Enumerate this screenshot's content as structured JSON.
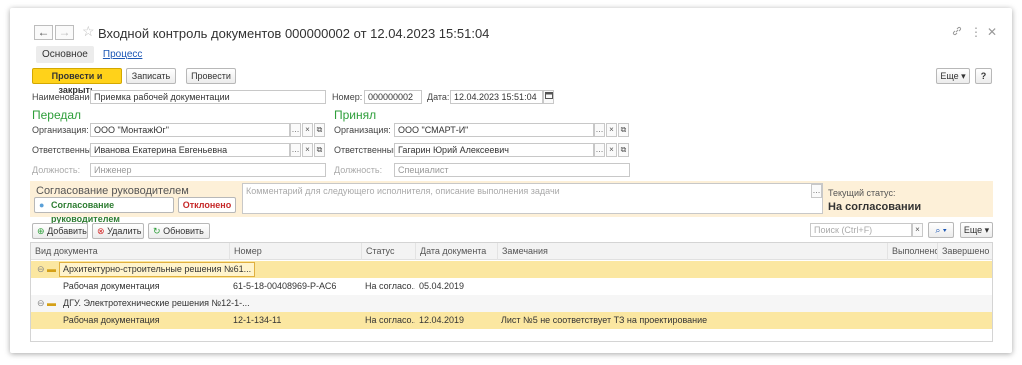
{
  "window": {
    "title": "Входной контроль документов 000000002 от 12.04.2023 15:51:04",
    "nav_back": "←",
    "nav_forward": "→",
    "star": "☆",
    "link_icon": "🔗",
    "more_icon": "⋮",
    "close_icon": "✕"
  },
  "tabs": {
    "main": "Основное",
    "process": "Процесс"
  },
  "toolbar": {
    "post_close": "Провести и закрыть",
    "save": "Записать",
    "post": "Провести",
    "more": "Еще",
    "help": "?"
  },
  "header": {
    "name_label": "Наименование:",
    "name_value": "Приемка рабочей документации",
    "number_label": "Номер:",
    "number_value": "000000002",
    "date_label": "Дата:",
    "date_value": "12.04.2023 15:51:04"
  },
  "sender": {
    "heading": "Передал",
    "org_label": "Организация:",
    "org_value": "ООО \"МонтажЮг\"",
    "resp_label": "Ответственный:",
    "resp_value": "Иванова Екатерина Евгеньевна",
    "pos_label": "Должность:",
    "pos_value": "Инженер"
  },
  "receiver": {
    "heading": "Принял",
    "org_label": "Организация:",
    "org_value": "ООО \"СМАРТ-И\"",
    "resp_label": "Ответственный:",
    "resp_value": "Гагарин Юрий Алексеевич",
    "pos_label": "Должность:",
    "pos_value": "Специалист"
  },
  "approval": {
    "title": "Согласование руководителем",
    "approve_button": "Согласование руководителем",
    "reject_button": "Отклонено",
    "comment_placeholder": "Комментарий для следующего исполнителя, описание выполнения задачи",
    "status_label": "Текущий статус:",
    "status_value": "На согласовании"
  },
  "table_toolbar": {
    "add": "Добавить",
    "delete": "Удалить",
    "refresh": "Обновить",
    "search_placeholder": "Поиск (Ctrl+F)",
    "more": "Еще"
  },
  "table": {
    "columns": [
      "Вид документа",
      "Номер",
      "Статус",
      "Дата документа",
      "Замечания",
      "Выполнено",
      "Завершено"
    ],
    "rows": [
      {
        "type": "group",
        "name": "Архитектурно-строительные решения №61...",
        "selected": true
      },
      {
        "type": "item",
        "doc": "Рабочая документация",
        "number": "61-5-18-00408969-Р-АС6",
        "status": "На согласо...",
        "date": "05.04.2019",
        "remarks": "",
        "selected": false
      },
      {
        "type": "group",
        "name": "ДГУ. Электротехнические решения №12-1-...",
        "selected": false
      },
      {
        "type": "item",
        "doc": "Рабочая документация",
        "number": "12-1-134-11",
        "status": "На согласо...",
        "date": "12.04.2019",
        "remarks": "Лист №5 не соответствует ТЗ на проектирование",
        "selected": true
      }
    ]
  }
}
